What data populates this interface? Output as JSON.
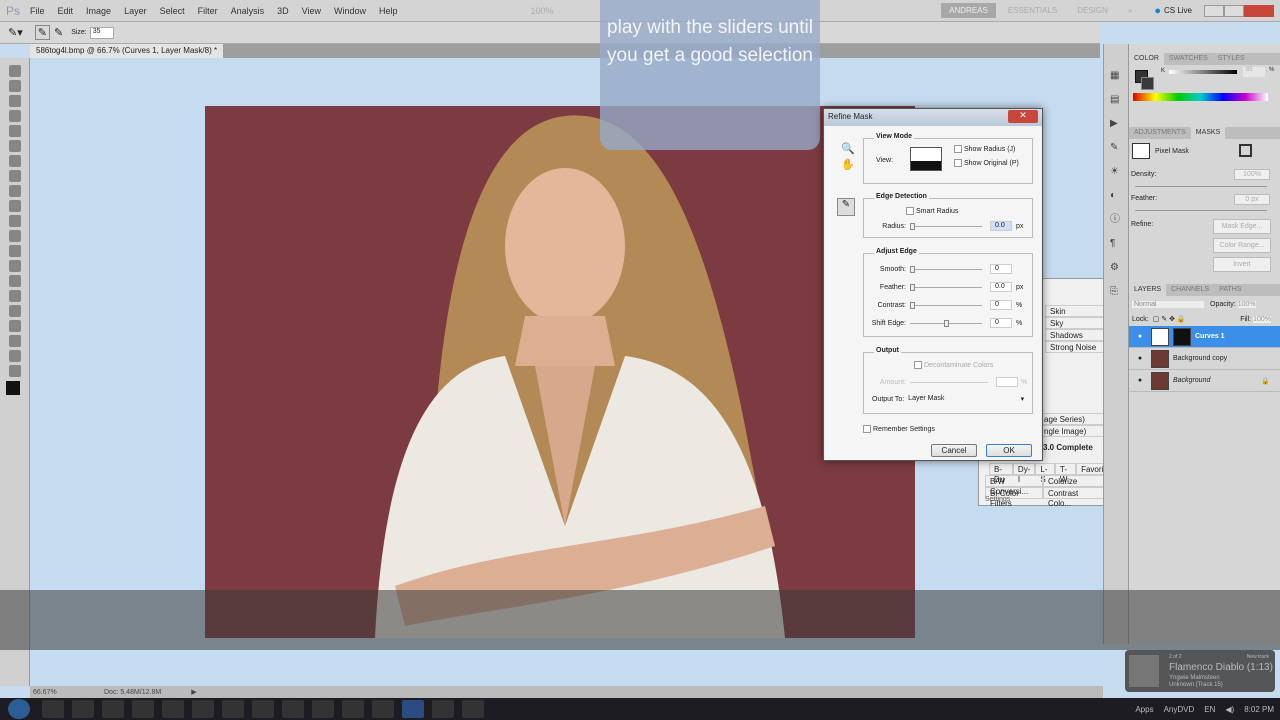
{
  "menubar": {
    "logo": "Ps",
    "items": [
      "File",
      "Edit",
      "Image",
      "Layer",
      "Select",
      "Filter",
      "Analysis",
      "3D",
      "View",
      "Window",
      "Help"
    ],
    "zoom": "100%",
    "workspaces": [
      "ANDREAS",
      "ESSENTIALS",
      "DESIGN"
    ],
    "more": "»",
    "cslive": "CS Live"
  },
  "options": {
    "size_label": "Size:",
    "size_value": "35"
  },
  "document": {
    "tab": "586tog4l.bmp @ 66.7% (Curves 1, Layer Mask/8) *"
  },
  "tooltip": {
    "text": "play with the sliders until you get a good selection"
  },
  "dialog": {
    "title": "Refine Mask",
    "view_mode": "View Mode",
    "view_label": "View:",
    "show_radius": "Show Radius (J)",
    "show_original": "Show Original (P)",
    "edge_detection": "Edge Detection",
    "smart_radius": "Smart Radius",
    "radius_label": "Radius:",
    "radius_value": "0.0",
    "px": "px",
    "adjust_edge": "Adjust Edge",
    "smooth_label": "Smooth:",
    "smooth_value": "0",
    "feather_label": "Feather:",
    "feather_value": "0.0",
    "contrast_label": "Contrast:",
    "contrast_value": "0",
    "shift_label": "Shift Edge:",
    "shift_value": "0",
    "pct": "%",
    "output": "Output",
    "decontaminate": "Decontaminate Colors",
    "amount_label": "Amount:",
    "output_to_label": "Output To:",
    "output_to_value": "Layer Mask",
    "remember": "Remember Settings",
    "cancel": "Cancel",
    "ok": "OK"
  },
  "bgpanel": {
    "items": [
      "Skin",
      "Sky",
      "Shadows",
      "Strong Noise"
    ],
    "series": "age Series)",
    "single": "ngle Image)",
    "complete": "3.0 Complete",
    "tabs": [
      "B-Du",
      "Dy-I",
      "L-S",
      "T-W",
      "Favorites"
    ],
    "grid": [
      "B/W Conversi...",
      "Colorize",
      "Bi-Color Filters",
      "Contrast Colo..."
    ],
    "settings": "Settings"
  },
  "color_panel": {
    "tabs": [
      "COLOR",
      "SWATCHES",
      "STYLES"
    ],
    "channel": "K",
    "value": "85",
    "pct": "%"
  },
  "masks_panel": {
    "tabs": [
      "ADJUSTMENTS",
      "MASKS"
    ],
    "pixel_mask": "Pixel Mask",
    "density_label": "Density:",
    "density_value": "100%",
    "feather_label": "Feather:",
    "feather_value": "0 px",
    "refine_label": "Refine:",
    "mask_edge": "Mask Edge...",
    "color_range": "Color Range...",
    "invert": "Invert"
  },
  "layers_panel": {
    "tabs": [
      "LAYERS",
      "CHANNELS",
      "PATHS"
    ],
    "blend": "Normal",
    "opacity_label": "Opacity:",
    "opacity_value": "100%",
    "lock_label": "Lock:",
    "fill_label": "Fill:",
    "fill_value": "100%",
    "layers": [
      {
        "name": "Curves 1",
        "selected": true
      },
      {
        "name": "Background copy"
      },
      {
        "name": "Background",
        "locked": true
      }
    ]
  },
  "status": {
    "zoom": "66.67%",
    "doc": "Doc: 5.48M/12.8M"
  },
  "taskbar": {
    "apps_label": "Apps",
    "anydvd": "AnyDVD",
    "lang": "EN",
    "time": "8:02 PM"
  },
  "music": {
    "count": "2 of 2",
    "label": "New track",
    "title": "Flamenco Diablo (1:13)",
    "artist": "Yngwie Malmsteen",
    "album": "Unknown (Track 15)"
  },
  "colors": {
    "photo_bg": "#7c3b40",
    "canvas": "#c5dbef",
    "selection": "#3b8fe8",
    "close": "#c9473a"
  }
}
